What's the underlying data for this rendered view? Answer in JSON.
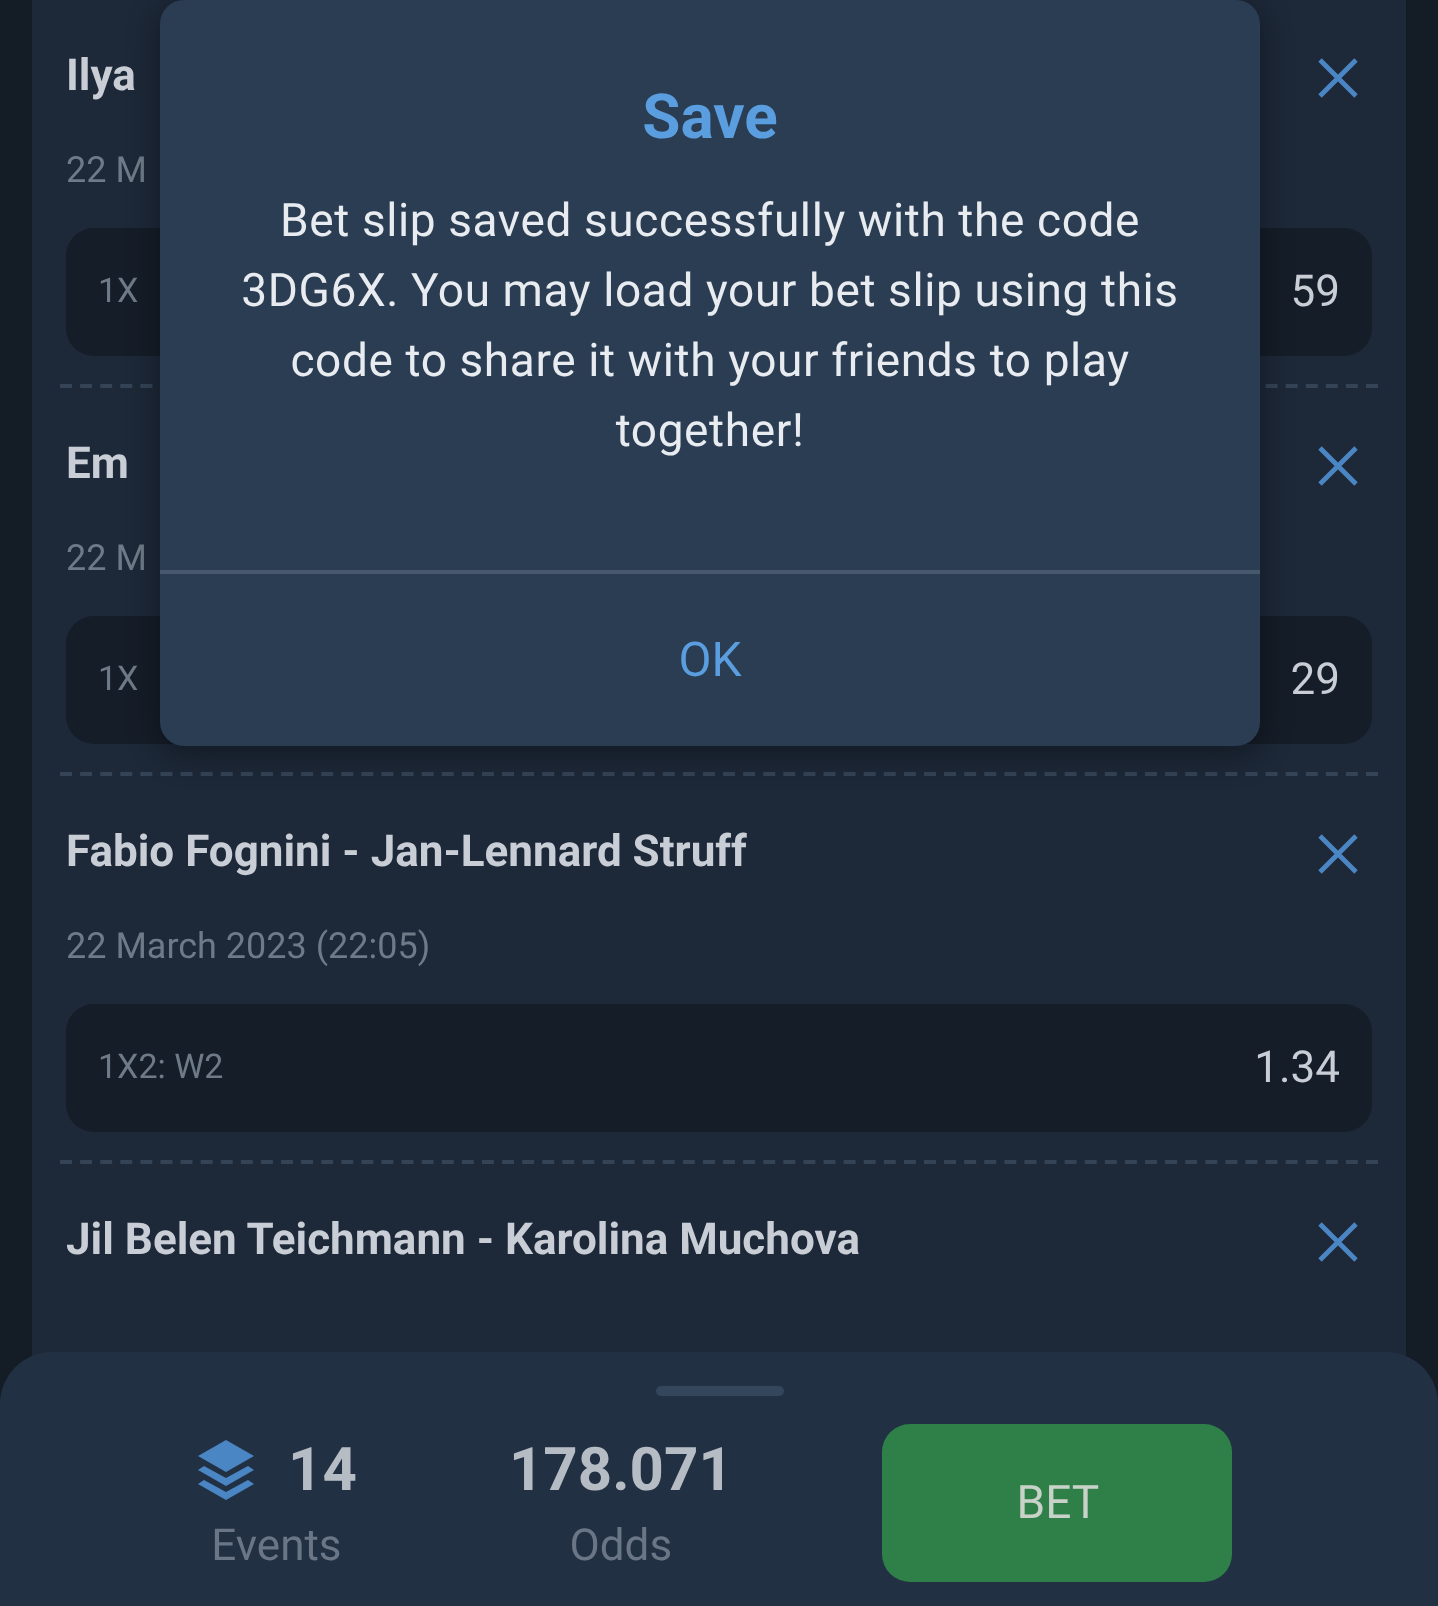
{
  "events": [
    {
      "title": "Ilya",
      "date": "22 M",
      "market": "1X",
      "odds": "59"
    },
    {
      "title": "Em",
      "date": "22 M",
      "market": "1X",
      "odds": "29"
    },
    {
      "title": "Fabio Fognini - Jan-Lennard Struff",
      "date": "22 March 2023 (22:05)",
      "market": "1X2: W2",
      "odds": "1.34"
    },
    {
      "title": "Jil Belen Teichmann - Karolina Muchova"
    }
  ],
  "summary": {
    "events_count": "14",
    "events_label": "Events",
    "odds": "178.071",
    "odds_label": "Odds",
    "bet_button": "BET"
  },
  "dialog": {
    "title": "Save",
    "message": "Bet slip saved successfully with the code 3DG6X. You may load your bet slip using this code to share it with your friends to play together!",
    "ok_button": "OK"
  }
}
